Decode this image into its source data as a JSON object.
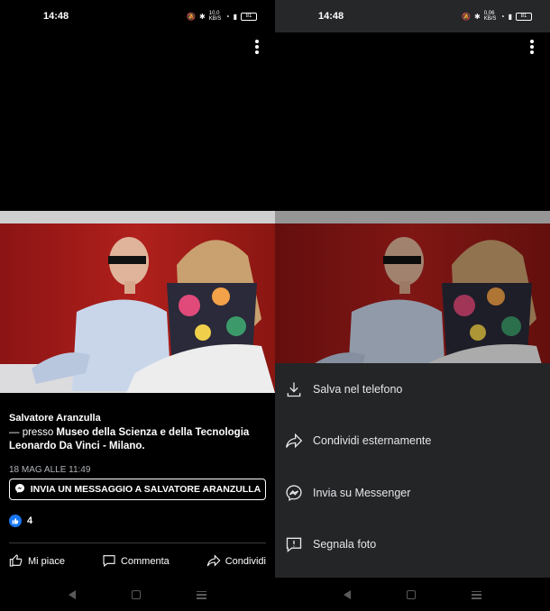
{
  "status": {
    "time": "14:48",
    "net_left": "10,0 KB/S",
    "net_right": "0,06 KB/S",
    "battery": "81"
  },
  "post": {
    "author": "Salvatore Aranzulla",
    "place_prefix": "— presso ",
    "place_name": "Museo della Scienza e della Tecnologia Leonardo Da Vinci - Milano.",
    "date": "18 MAG ALLE 11:49"
  },
  "messenger_button": "INVIA UN MESSAGGIO A SALVATORE ARANZULLA",
  "reactions": {
    "count": "4"
  },
  "actions": {
    "like": "Mi piace",
    "comment": "Commenta",
    "share": "Condividi"
  },
  "sheet": {
    "items": [
      {
        "label": "Salva nel telefono",
        "icon": "download-icon"
      },
      {
        "label": "Condividi esternamente",
        "icon": "share-icon"
      },
      {
        "label": "Invia su Messenger",
        "icon": "messenger-icon"
      },
      {
        "label": "Segnala foto",
        "icon": "report-icon"
      }
    ]
  },
  "colors": {
    "background": "#000000",
    "sheet": "#242526",
    "accent": "#1877f2",
    "secondary_text": "#b0b3b8"
  }
}
